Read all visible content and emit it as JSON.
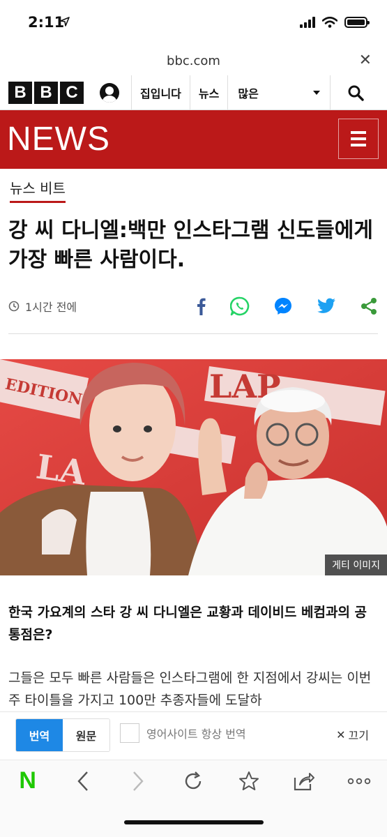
{
  "status_bar": {
    "time": "2:11"
  },
  "url_bar": {
    "url": "bbc.com"
  },
  "header": {
    "logo_letters": [
      "B",
      "B",
      "C"
    ],
    "nav_home": "집입니다",
    "nav_news": "뉴스",
    "nav_more": "많은"
  },
  "banner": {
    "title": "NEWS"
  },
  "article": {
    "section": "뉴스 비트",
    "headline": "강 씨 다니엘:백만 인스타그램 신도들에게 가장 빠른 사람이다.",
    "time_ago": "1시간 전에",
    "share_icons": [
      "facebook-icon",
      "whatsapp-icon",
      "messenger-icon",
      "twitter-icon",
      "share-icon"
    ],
    "image_credit": "게티 이미지",
    "summary": "한국 가요계의 스타 강 씨 다니엘은 교황과 데이비드 베컴과의 공통점은?",
    "body": "그들은 모두 빠른 사람들은 인스타그램에 한 지점에서 강씨는 이번 주 타이틀을 가지고 100만 추종자들에 도달하"
  },
  "translation_bar": {
    "translate_label": "번역",
    "original_label": "원문",
    "always_translate_label": "영어사이트 항상 번역",
    "off_label": "끄기"
  },
  "toolbar": {
    "items": [
      "naver-icon",
      "back-icon",
      "forward-icon",
      "reload-icon",
      "bookmark-icon",
      "share-icon",
      "more-icon"
    ],
    "naver_letter": "N"
  },
  "colors": {
    "bbc_red": "#bb1919",
    "translate_blue": "#1e88e5",
    "naver_green": "#1ec800"
  }
}
